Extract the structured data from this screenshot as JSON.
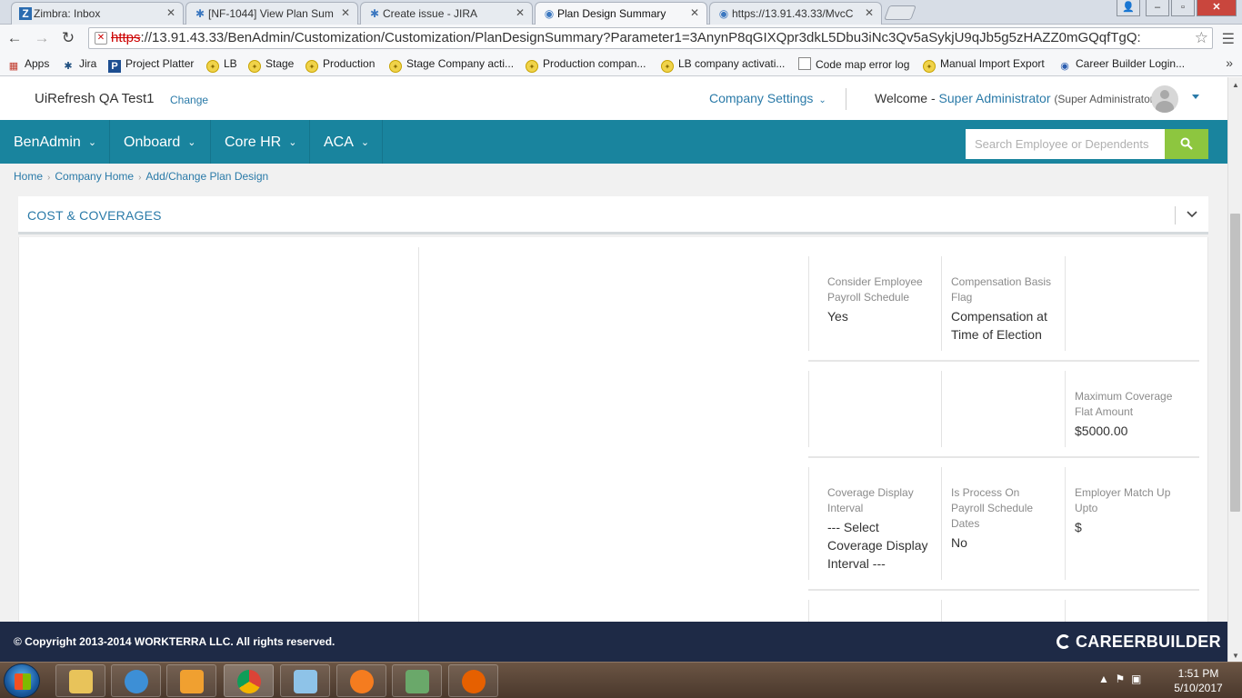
{
  "browser": {
    "tabs": [
      {
        "title": "Zimbra: Inbox",
        "icon": "zimbra-icon"
      },
      {
        "title": "[NF-1044] View Plan Sum",
        "icon": "jira-icon"
      },
      {
        "title": "Create issue - JIRA",
        "icon": "jira-icon"
      },
      {
        "title": "Plan Design Summary",
        "icon": "page-icon",
        "active": true
      },
      {
        "title": "https://13.91.43.33/MvcC",
        "icon": "page-icon"
      }
    ],
    "url_scheme": "https",
    "url_rest": "://13.91.43.33/BenAdmin/Customization/Customization/PlanDesignSummary?Parameter1=3AnynP8qGIXQpr3dkL5Dbu3iNc3Qv5aSykjU9qJb5g5zHAZZ0mGQqfTgQ:",
    "bookmarks": [
      {
        "label": "Apps",
        "icon": "apps-icon"
      },
      {
        "label": "Jira",
        "icon": "jira-icon"
      },
      {
        "label": "Project Platter",
        "icon": "p-icon"
      },
      {
        "label": "LB",
        "icon": "gear-icon"
      },
      {
        "label": "Stage",
        "icon": "gear-icon"
      },
      {
        "label": "Production",
        "icon": "gear-icon"
      },
      {
        "label": "Stage Company acti...",
        "icon": "gear-icon"
      },
      {
        "label": "Production compan...",
        "icon": "gear-icon"
      },
      {
        "label": "LB company activati...",
        "icon": "gear-icon"
      },
      {
        "label": "Code map error log",
        "icon": "doc-icon"
      },
      {
        "label": "Manual Import Export",
        "icon": "gear-icon"
      },
      {
        "label": "Career Builder Login...",
        "icon": "cb-icon"
      }
    ],
    "bookmarks_more": "»"
  },
  "header": {
    "company": "UiRefresh QA Test1",
    "change_label": "Change",
    "company_settings": "Company Settings",
    "welcome": "Welcome -",
    "user_name": "Super Administrator",
    "user_role": "(Super Administrator)"
  },
  "nav": {
    "items": [
      "BenAdmin",
      "Onboard",
      "Core HR",
      "ACA"
    ],
    "search_placeholder": "Search Employee or Dependents"
  },
  "breadcrumb": [
    "Home",
    "Company Home",
    "Add/Change Plan Design"
  ],
  "section": {
    "title": "COST & COVERAGES",
    "rows": [
      [
        {
          "label": "Consider Employee Payroll Schedule",
          "value": "Yes"
        },
        {
          "label": "Compensation Basis Flag",
          "value": "Compensation at Time of Election"
        },
        {
          "label": "",
          "value": ""
        }
      ],
      [
        {
          "label": "",
          "value": ""
        },
        {
          "label": "",
          "value": ""
        },
        {
          "label": "Maximum Coverage Flat Amount",
          "value": "$5000.00"
        }
      ],
      [
        {
          "label": "Coverage Display Interval",
          "value": "--- Select Coverage Display Interval ---"
        },
        {
          "label": "Is Process On Payroll Schedule Dates",
          "value": "No"
        },
        {
          "label": "Employer Match Up Upto",
          "value": "$"
        }
      ],
      [
        {
          "label": "",
          "value": ""
        },
        {
          "label": "",
          "value": ""
        },
        {
          "label": "",
          "value": ""
        }
      ]
    ]
  },
  "footer": {
    "copyright": "© Copyright 2013-2014 WORKTERRA LLC. All rights reserved.",
    "brand": "CAREERBUILDER"
  },
  "taskbar": {
    "time": "1:51 PM",
    "date": "5/10/2017",
    "colors": {
      "explorer": "#e8c35a",
      "ie": "#3d8fd6",
      "media": "#f0a030",
      "chrome": "#db4437",
      "notepad": "#8ec3e8",
      "firefox-alt": "#f57c1f",
      "calc": "#6aa86a",
      "firefox": "#e66000"
    }
  },
  "theme": {
    "nav_bg": "#19849e",
    "accent": "#2a7aa8",
    "search_button": "#8dc63f",
    "footer_bg": "#1e2a46"
  }
}
